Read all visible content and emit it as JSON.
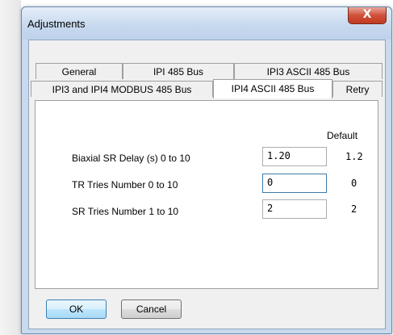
{
  "window": {
    "title": "Adjustments",
    "close_glyph": "X"
  },
  "tabs": {
    "row1": [
      "General",
      "IPI 485 Bus",
      "IPI3 ASCII 485 Bus"
    ],
    "row2": [
      "IPI3 and IPI4 MODBUS 485 Bus",
      "IPI4 ASCII 485 Bus",
      "Retry"
    ],
    "active": "IPI4 ASCII 485 Bus"
  },
  "panel": {
    "default_header": "Default",
    "rows": [
      {
        "label": "Biaxial SR Delay (s)  0 to 10",
        "value": "1.20",
        "default": "1.2"
      },
      {
        "label": "TR Tries Number  0 to 10",
        "value": "0",
        "default": "0"
      },
      {
        "label": "SR Tries Number  1 to 10",
        "value": "2",
        "default": "2"
      }
    ]
  },
  "buttons": {
    "ok": "OK",
    "cancel": "Cancel"
  },
  "colors": {
    "titlebar": "#c6d8ee",
    "close": "#c23a22",
    "focus_border": "#3d7bad"
  }
}
